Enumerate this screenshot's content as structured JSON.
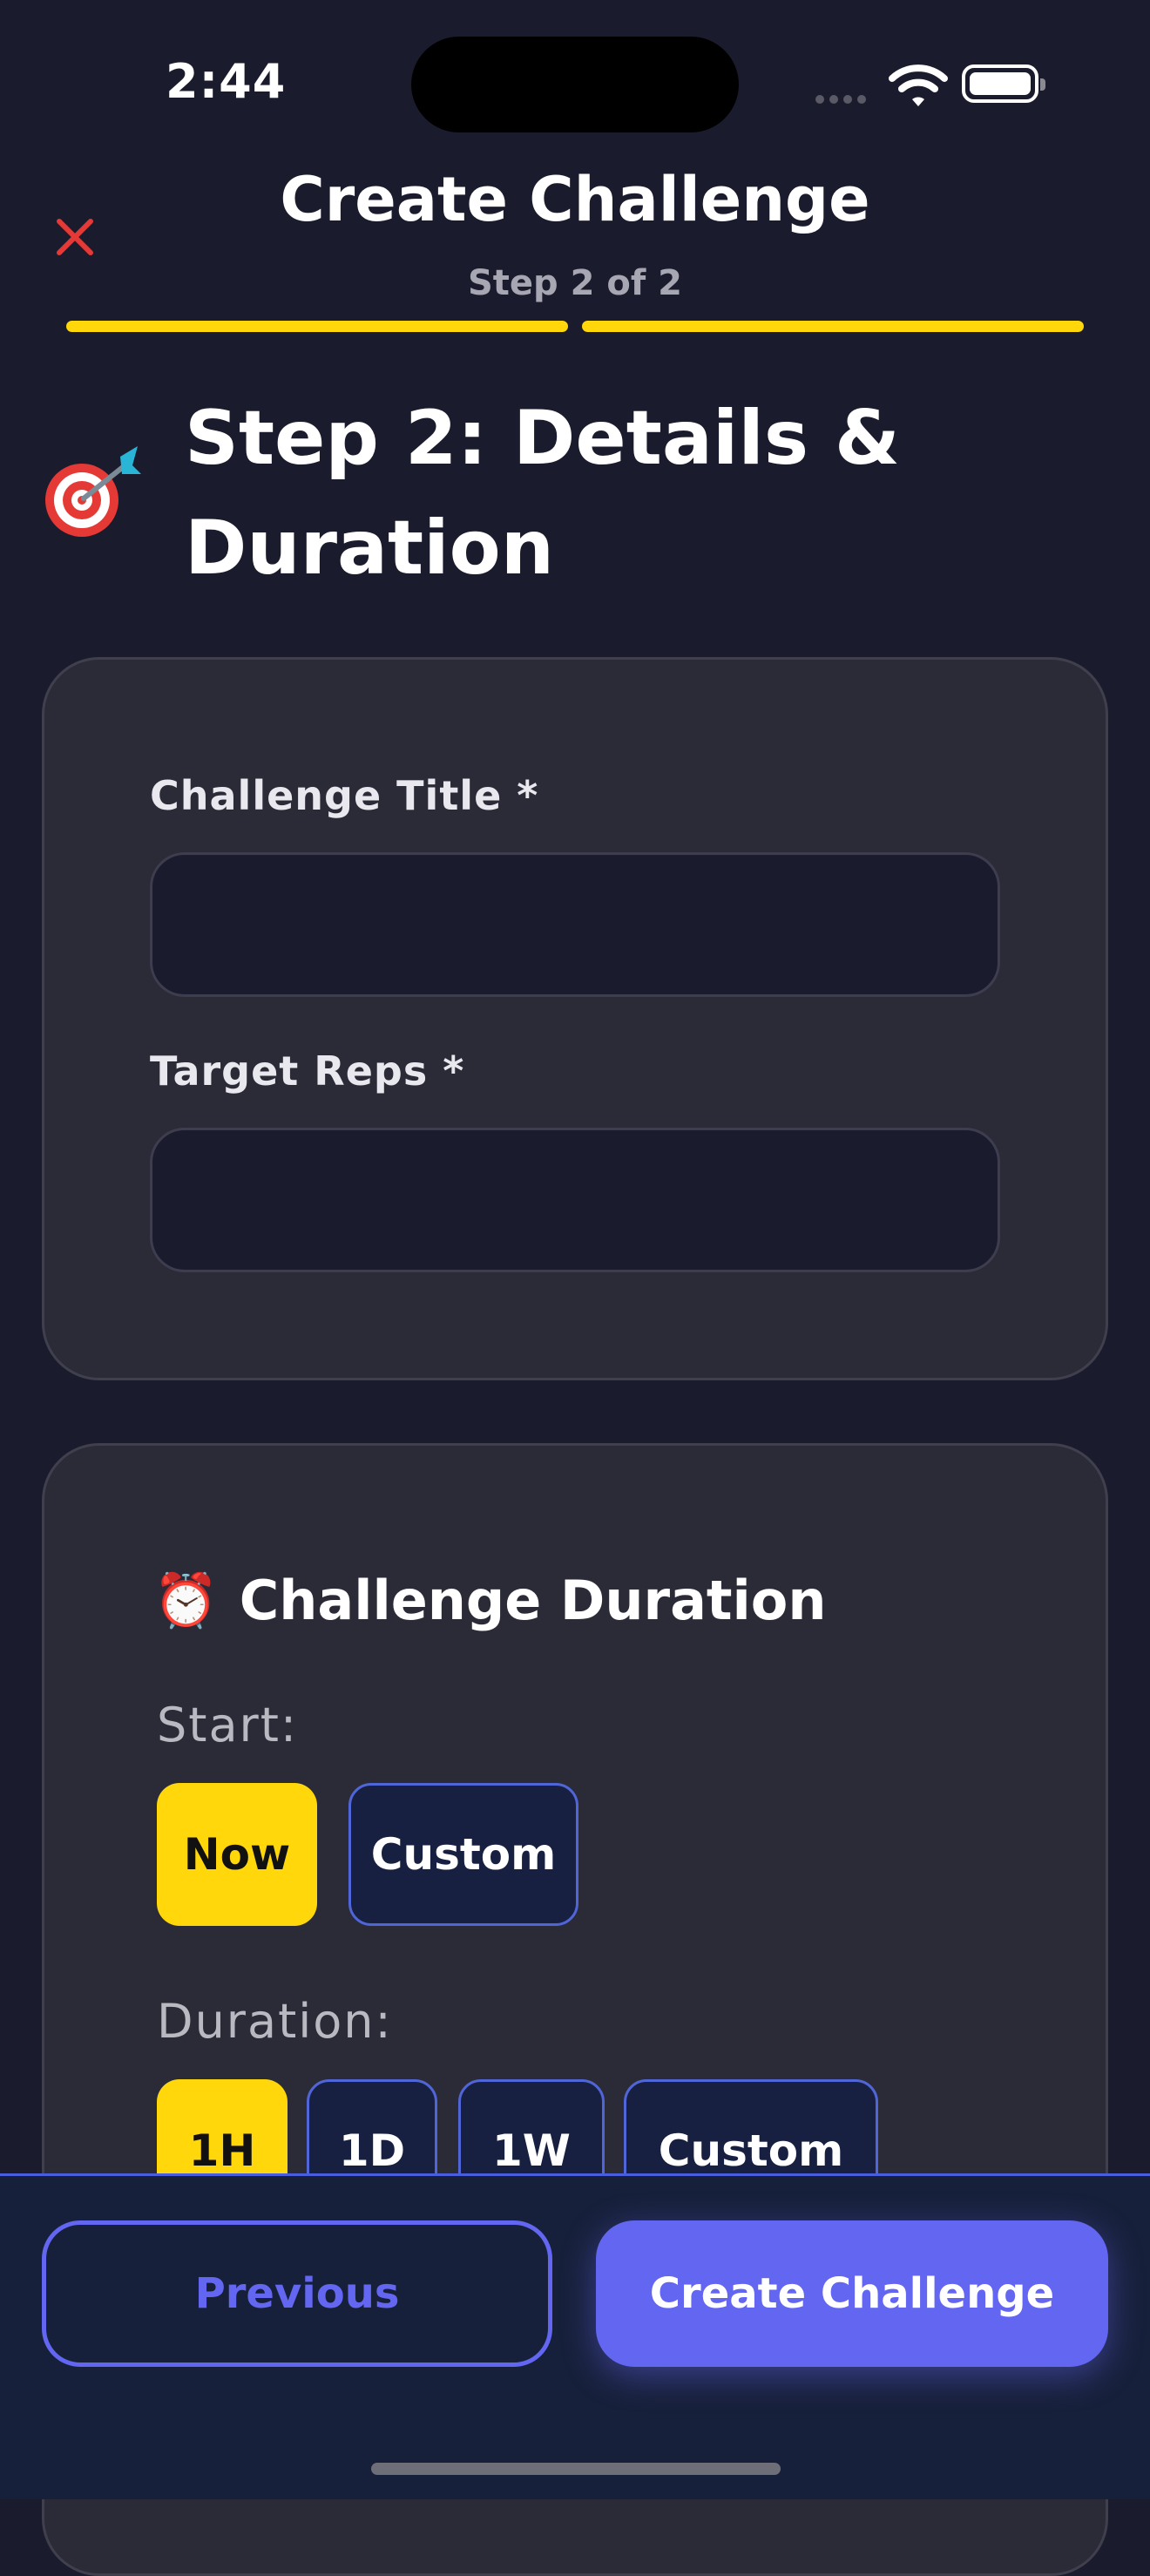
{
  "status_bar": {
    "time": "2:44"
  },
  "header": {
    "title": "Create Challenge",
    "step_indicator": "Step 2 of 2",
    "progress": {
      "completed_steps": 2,
      "total_steps": 2
    }
  },
  "step": {
    "emoji": "dart-target-icon",
    "heading": "Step 2: Details & Duration"
  },
  "form": {
    "title_label": "Challenge Title *",
    "title_value": "",
    "reps_label": "Target Reps *",
    "reps_value": ""
  },
  "duration": {
    "title": "Challenge Duration",
    "icon": "alarm-clock-icon",
    "start_label": "Start:",
    "start_options": [
      "Now",
      "Custom"
    ],
    "start_selected": "Now",
    "duration_label": "Duration:",
    "duration_options": [
      "1H",
      "1D",
      "1W",
      "Custom"
    ],
    "duration_selected": "1H"
  },
  "footer": {
    "previous_label": "Previous",
    "create_label": "Create Challenge"
  },
  "colors": {
    "background": "#1b1b2e",
    "accent": "#ffd70a",
    "primary": "#6366f1",
    "close": "#e53935"
  }
}
